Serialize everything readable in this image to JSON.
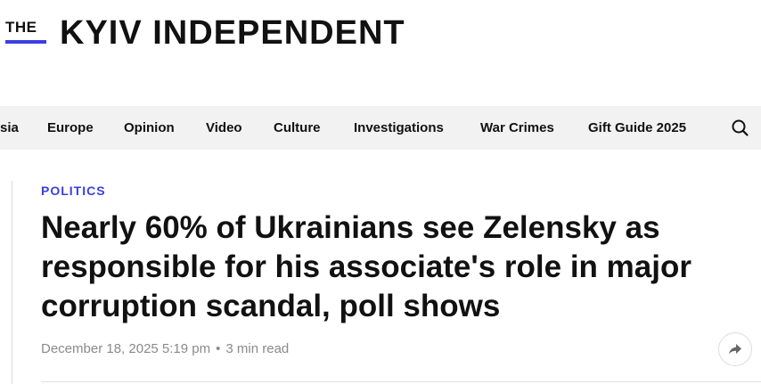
{
  "site": {
    "logo_the": "THE",
    "logo_main": "KYIV INDEPENDENT",
    "accent_color": "#3a3fe0"
  },
  "nav": {
    "items": [
      "sia",
      "Europe",
      "Opinion",
      "Video",
      "Culture",
      "Investigations",
      "War Crimes",
      "Gift Guide 2025"
    ],
    "search_icon": "search-icon"
  },
  "article": {
    "category": "POLITICS",
    "headline": "Nearly 60% of Ukrainians see Zelensky as responsible for his associate's role in major corruption scandal, poll shows",
    "date": "December 18, 2025 5:19 pm",
    "separator": "•",
    "read_time": "3 min read",
    "share_icon": "share-icon"
  }
}
